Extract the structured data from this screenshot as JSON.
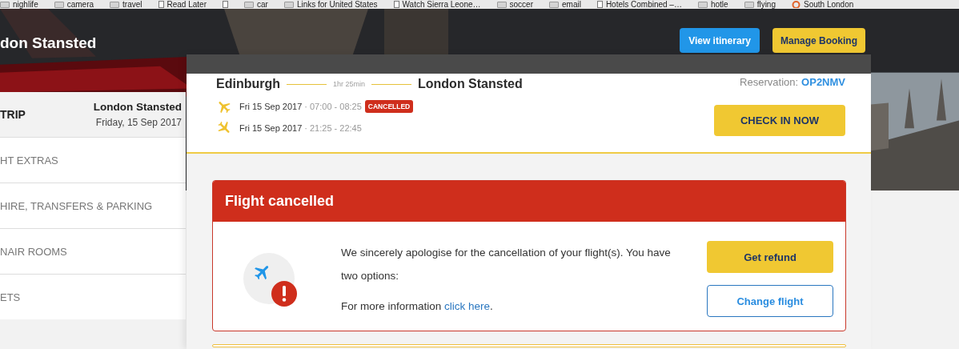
{
  "bookmarks": [
    {
      "kind": "folder",
      "label": "nighlife"
    },
    {
      "kind": "folder",
      "label": "camera"
    },
    {
      "kind": "folder",
      "label": "travel"
    },
    {
      "kind": "page",
      "label": "Read Later"
    },
    {
      "kind": "page"
    },
    {
      "kind": "folder",
      "label": "car"
    },
    {
      "kind": "folder",
      "label": "Links for United States"
    },
    {
      "kind": "page",
      "label": "Watch Sierra Leone…"
    },
    {
      "kind": "folder",
      "label": "soccer"
    },
    {
      "kind": "folder",
      "label": "email"
    },
    {
      "kind": "page",
      "label": "Hotels Combined –…"
    },
    {
      "kind": "folder",
      "label": "hotle"
    },
    {
      "kind": "folder",
      "label": "flying"
    },
    {
      "kind": "site",
      "label": "South London"
    }
  ],
  "header": {
    "title": "don Stansted",
    "buttons": [
      {
        "kind": "secondary",
        "label": "View itinerary"
      },
      {
        "kind": "primary",
        "label": "Manage Booking"
      }
    ]
  },
  "sidebar": {
    "trip": {
      "label": "TRIP",
      "destination": "London Stansted",
      "date": "Friday, 15 Sep 2017"
    },
    "items": [
      "HT EXTRAS",
      "HIRE, TRANSFERS & PARKING",
      "NAIR ROOMS",
      "ETS"
    ]
  },
  "booking": {
    "origin": "Edinburgh",
    "duration": "1hr 25min",
    "destination": "London Stansted",
    "flights": [
      {
        "kind": "outbound",
        "date": "Fri 15 Sep 2017",
        "times": "· 07:00 - 08:25",
        "status": "CANCELLED"
      },
      {
        "kind": "return",
        "date": "Fri 15 Sep 2017",
        "times": "· 21:25 - 22:45"
      }
    ],
    "reservation_label": "Reservation:",
    "reservation_code": "OP2NMV",
    "check_in_button": "CHECK IN NOW"
  },
  "alert": {
    "title": "Flight cancelled",
    "message": "We sincerely apologise for the cancellation of your flight(s). You have two options:",
    "info": "For more information",
    "link": "click here",
    "info_end": ".",
    "buttons": [
      {
        "kind": "primary",
        "label": "Get refund"
      },
      {
        "kind": "outline",
        "label": "Change flight"
      }
    ]
  }
}
